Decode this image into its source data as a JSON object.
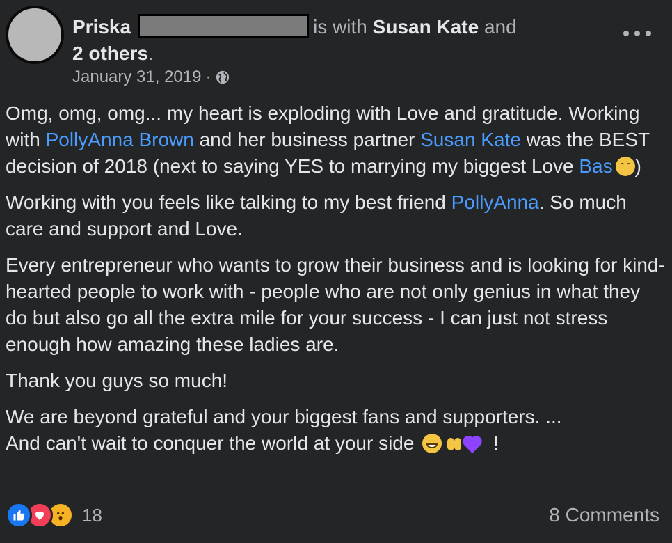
{
  "post": {
    "author": {
      "first_name": "Priska",
      "with_text": "is with",
      "tagged_name": "Susan Kate",
      "and_text": "and",
      "others_text": "2 others",
      "end_period": "."
    },
    "date": "January 31, 2019",
    "separator": "·",
    "privacy_icon": "globe-icon",
    "more_menu_icon": "more-horizontal-icon"
  },
  "body": {
    "p1_part1": "Omg, omg, omg... my heart is exploding with Love and gratitude. Working with ",
    "p1_mention1": "PollyAnna Brown",
    "p1_part2": " and her business partner ",
    "p1_mention2": "Susan Kate",
    "p1_part3": " was the BEST decision of 2018 (next to saying YES to marrying my biggest Love ",
    "p1_mention3": "Bas",
    "p1_part4": ")",
    "p2_part1": "Working with you feels like talking to my best friend ",
    "p2_mention1": "PollyAnna",
    "p2_part2": ". So much care and support and Love.",
    "p3": "Every entrepreneur who wants to grow their business and is looking for kind-hearted people to work with - people who are not only genius in what they do but also go all the extra mile for your success - I can just not stress enough how amazing these ladies are.",
    "p4": "Thank you guys so much!",
    "p5_line1": "We are beyond grateful and your biggest fans and supporters. ...",
    "p5_line2": "And can't wait to conquer the world at your side",
    "p5_end": " !"
  },
  "footer": {
    "reaction_count": "18",
    "comments_label": "8 Comments",
    "reactions": [
      {
        "icon": "like-icon",
        "color": "#1877f2"
      },
      {
        "icon": "love-icon",
        "color": "#f33e58"
      },
      {
        "icon": "wow-icon",
        "color": "#f7b125"
      }
    ]
  },
  "colors": {
    "background": "#242526",
    "text_primary": "#e4e6eb",
    "text_secondary": "#b0b3b8",
    "mention": "#4b9cff"
  }
}
